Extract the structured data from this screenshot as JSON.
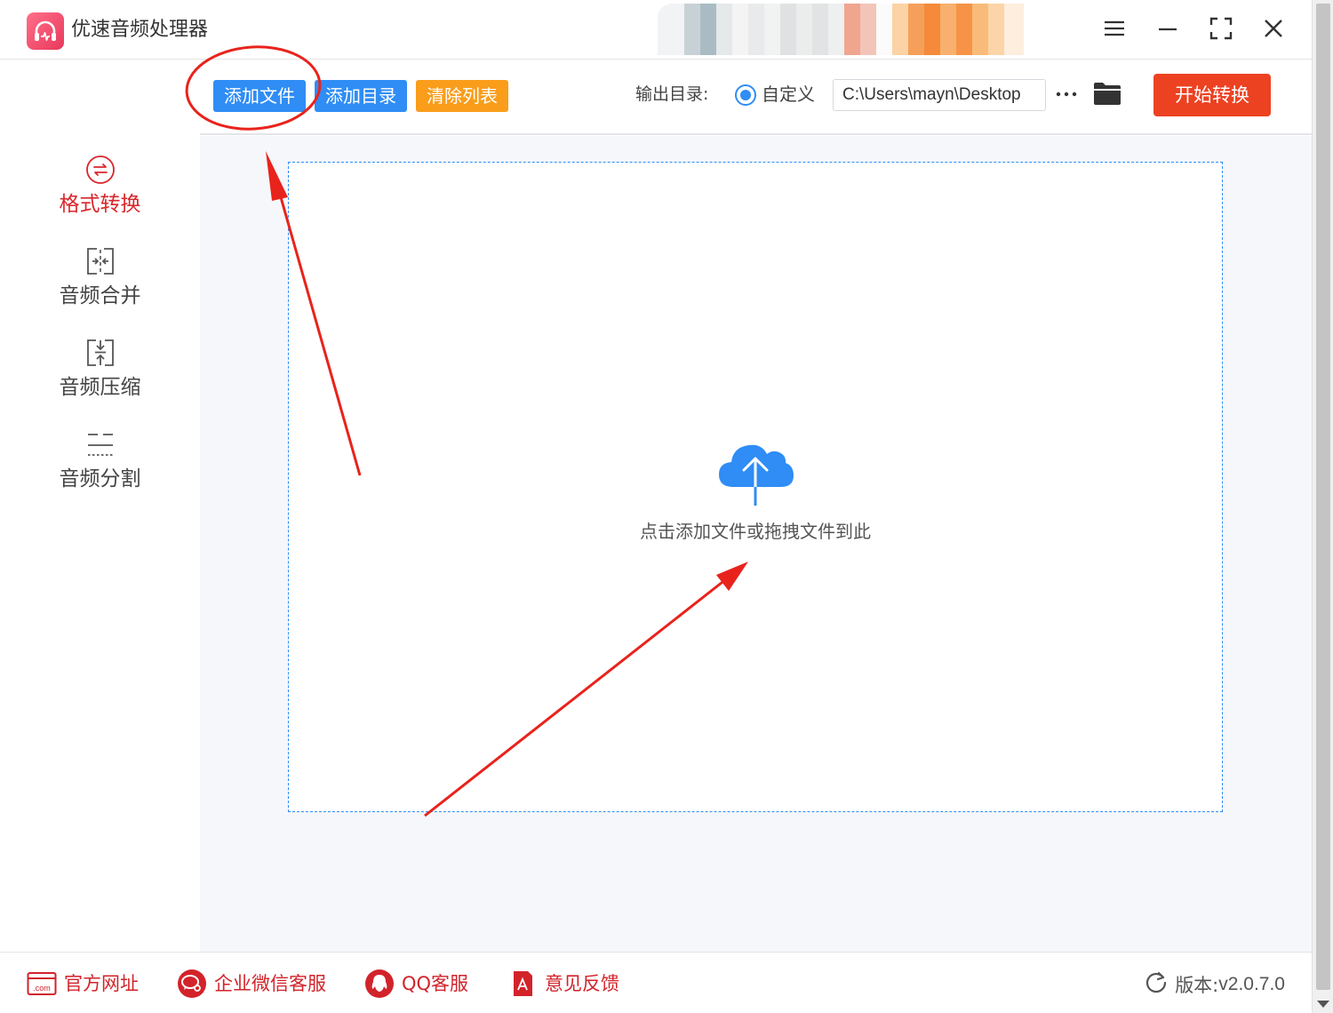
{
  "app": {
    "title": "优速音频处理器",
    "logo_icon": "headphones-icon",
    "accent_color": "#e8395c"
  },
  "window_controls": [
    "menu-icon",
    "minimize-icon",
    "maximize-icon",
    "close-icon"
  ],
  "sidebar": {
    "items": [
      {
        "label": "格式转换",
        "icon": "convert-icon",
        "active": true
      },
      {
        "label": "音频合并",
        "icon": "merge-icon",
        "active": false
      },
      {
        "label": "音频压缩",
        "icon": "compress-icon",
        "active": false
      },
      {
        "label": "音频分割",
        "icon": "split-icon",
        "active": false
      }
    ],
    "active_color": "#d9262b"
  },
  "toolbar": {
    "add_file": "添加文件",
    "add_folder": "添加目录",
    "clear_list": "清除列表",
    "output_label": "输出目录:",
    "radio_custom": "自定义",
    "output_path": "C:\\Users\\mayn\\Desktop",
    "more_icon": "ellipsis-icon",
    "folder_icon": "folder-icon",
    "start": "开始转换",
    "colors": {
      "blue": "#2f8df5",
      "orange": "#f99d1b",
      "start": "#ec4222"
    }
  },
  "dropzone": {
    "text": "点击添加文件或拖拽文件到此",
    "icon": "cloud-upload-icon"
  },
  "footer": {
    "links": [
      {
        "label": "官方网址",
        "icon": "website-icon"
      },
      {
        "label": "企业微信客服",
        "icon": "wechat-icon"
      },
      {
        "label": "QQ客服",
        "icon": "qq-icon"
      },
      {
        "label": "意见反馈",
        "icon": "feedback-icon"
      }
    ],
    "version_label": "版本:",
    "version": "v2.0.7.0",
    "version_icon": "refresh-icon"
  }
}
